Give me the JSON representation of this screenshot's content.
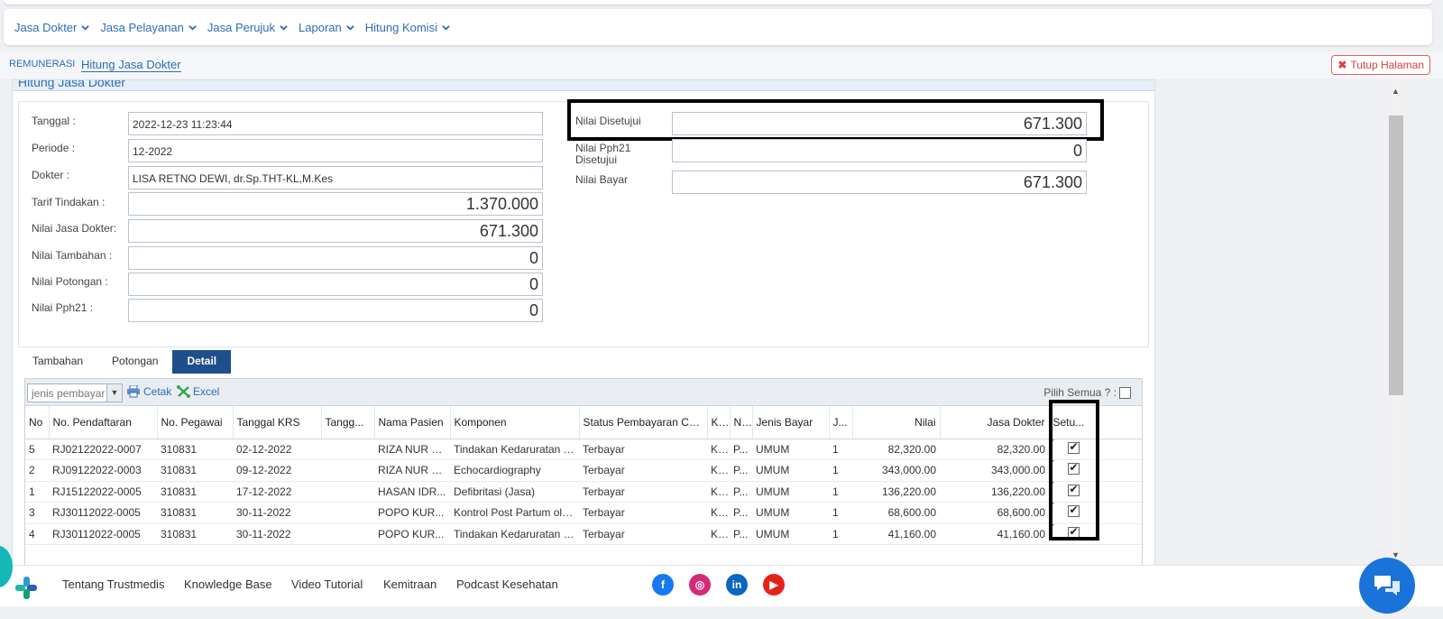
{
  "menu": [
    "Jasa Dokter",
    "Jasa Pelayanan",
    "Jasa Perujuk",
    "Laporan",
    "Hitung Komisi"
  ],
  "breadcrumb": {
    "root": "REMUNERASI",
    "current": "Hitung Jasa Dokter"
  },
  "close_label": "Tutup Halaman",
  "panel_title": "Hitung Jasa Dokter",
  "form": {
    "tanggal_label": "Tanggal :",
    "tanggal": "2022-12-23 11:23:44",
    "periode_label": "Periode :",
    "periode": "12-2022",
    "dokter_label": "Dokter :",
    "dokter": "LISA RETNO DEWI, dr.Sp.THT-KL,M.Kes",
    "tarif_label": "Tarif Tindakan :",
    "tarif": "1.370.000",
    "jasa_label": "Nilai Jasa Dokter:",
    "jasa": "671.300",
    "tambahan_label": "Nilai Tambahan :",
    "tambahan": "0",
    "potongan_label": "Nilai Potongan :",
    "potongan": "0",
    "pph21_label": "Nilai Pph21 :",
    "pph21": "0",
    "disetujui_label": "Nilai Disetujui",
    "disetujui": "671.300",
    "pph21_disetujui_label_1": "Nilai Pph21",
    "pph21_disetujui_label_2": "Disetujui",
    "pph21_disetujui": "0",
    "bayar_label": "Nilai Bayar",
    "bayar": "671.300"
  },
  "tabs": [
    "Tambahan",
    "Potongan",
    "Detail"
  ],
  "toolbar": {
    "select_placeholder": "jenis pembayar",
    "cetak": "Cetak",
    "excel": "Excel",
    "pilih_semua": "Pilih Semua ? :"
  },
  "table": {
    "headers": [
      "No",
      "No. Pendaftaran",
      "No. Pegawai",
      "Tanggal KRS",
      "Tangg...",
      "Nama Pasien",
      "Komponen",
      "Status Pembayaran Cust",
      "K...",
      "N...",
      "Jenis Bayar",
      "J...",
      "Nilai",
      "Jasa Dokter",
      "Setu..."
    ],
    "rows": [
      [
        "5",
        "RJ02122022-0007",
        "310831",
        "02-12-2022",
        "",
        "RIZA NUR FI...",
        "Tindakan Kedaruratan S...",
        "Terbayar",
        "K...",
        "P...",
        "UMUM",
        "1",
        "82,320.00",
        "82,320.00"
      ],
      [
        "2",
        "RJ09122022-0003",
        "310831",
        "09-12-2022",
        "",
        "RIZA NUR FI...",
        "Echocardiography",
        "Terbayar",
        "K...",
        "P...",
        "UMUM",
        "1",
        "343,000.00",
        "343,000.00"
      ],
      [
        "1",
        "RJ15122022-0005",
        "310831",
        "17-12-2022",
        "",
        "HASAN IDR...",
        "Defibritasi (Jasa)",
        "Terbayar",
        "K...",
        "P...",
        "UMUM",
        "1",
        "136,220.00",
        "136,220.00"
      ],
      [
        "3",
        "RJ30112022-0005",
        "310831",
        "30-11-2022",
        "",
        "POPO KUR...",
        "Kontrol Post Partum ole...",
        "Terbayar",
        "K...",
        "P...",
        "UMUM",
        "1",
        "68,600.00",
        "68,600.00"
      ],
      [
        "4",
        "RJ30112022-0005",
        "310831",
        "30-11-2022",
        "",
        "POPO KUR...",
        "Tindakan Kedaruratan R...",
        "Terbayar",
        "K...",
        "P...",
        "UMUM",
        "1",
        "41,160.00",
        "41,160.00"
      ]
    ]
  },
  "footer_links": [
    "Tentang Trustmedis",
    "Knowledge Base",
    "Video Tutorial",
    "Kemitraan",
    "Podcast Kesehatan"
  ],
  "social": [
    {
      "name": "facebook-icon",
      "glyph": "f",
      "color": "#1877f2"
    },
    {
      "name": "instagram-icon",
      "glyph": "◎",
      "color": "#d62976"
    },
    {
      "name": "linkedin-icon",
      "glyph": "in",
      "color": "#0a66c2"
    },
    {
      "name": "youtube-icon",
      "glyph": "▶",
      "color": "#e62117"
    }
  ]
}
